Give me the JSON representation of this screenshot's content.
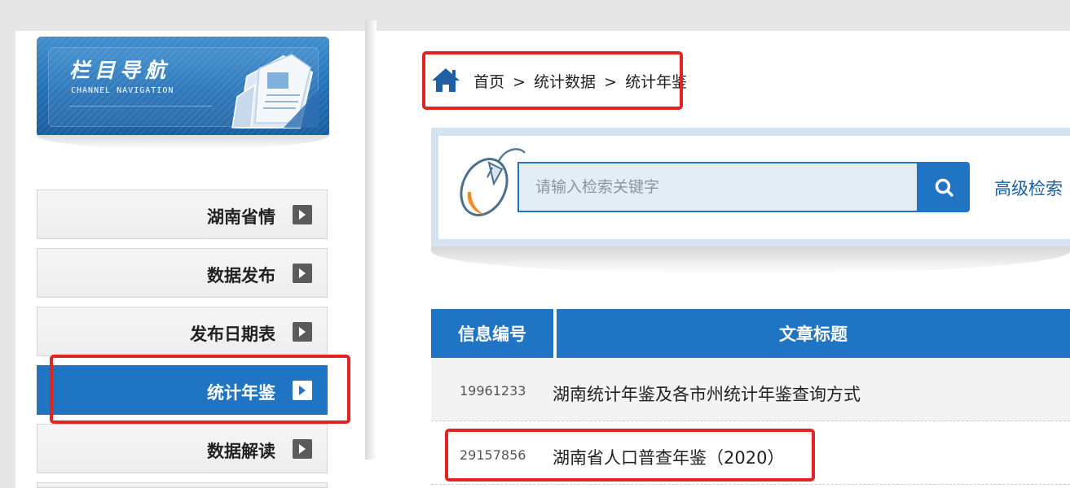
{
  "sidebar": {
    "banner": {
      "title_cn": "栏目导航",
      "title_en": "CHANNEL NAVIGATION"
    },
    "items": [
      {
        "label": "湖南省情",
        "active": false
      },
      {
        "label": "数据发布",
        "active": false
      },
      {
        "label": "发布日期表",
        "active": false
      },
      {
        "label": "统计年鉴",
        "active": true
      },
      {
        "label": "数据解读",
        "active": false
      }
    ]
  },
  "breadcrumb": {
    "home": "首页",
    "sep1": ">",
    "level1": "统计数据",
    "sep2": ">",
    "current": "统计年鉴"
  },
  "search": {
    "placeholder": "请输入检索关键字",
    "value": "",
    "advanced_label": "高级检索"
  },
  "table": {
    "headers": [
      "信息编号",
      "文章标题"
    ],
    "rows": [
      {
        "id": "19961233",
        "title": "湖南统计年鉴及各市州统计年鉴查询方式"
      },
      {
        "id": "29157856",
        "title": "湖南省人口普查年鉴（2020）"
      }
    ]
  },
  "colors": {
    "accent": "#1f74c3",
    "highlight": "#e02424",
    "background": "#e6e6e6"
  },
  "icons": {
    "home": "home-icon",
    "search": "search-icon",
    "arrow": "arrow-right-icon",
    "mouse": "mouse-icon",
    "document": "document-icon"
  }
}
